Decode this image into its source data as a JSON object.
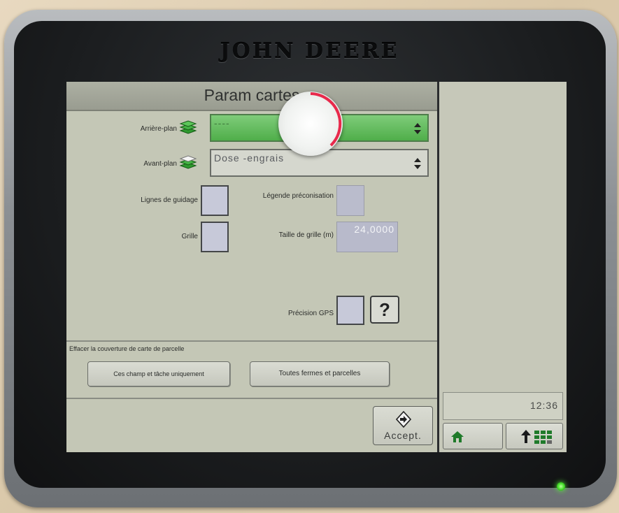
{
  "device": {
    "brand": "JOHN DEERE",
    "status_led_color": "#49e02c"
  },
  "screen": {
    "title": "Param cartes",
    "background_layer": {
      "label": "Arrière-plan",
      "value": "----",
      "icon": "layers-green-icon"
    },
    "foreground_layer": {
      "label": "Avant-plan",
      "value": "Dose -engrais",
      "icon": "layers-white-icon"
    },
    "guidance_lines": {
      "label": "Lignes de guidage",
      "checked": false
    },
    "prescription_legend": {
      "label": "Légende préconisation",
      "checked": false
    },
    "grid": {
      "label": "Grille",
      "checked": false
    },
    "grid_size": {
      "label": "Taille de grille (m)",
      "value": "24,0000"
    },
    "gps_precision": {
      "label": "Précision GPS",
      "checked": false,
      "help_label": "?"
    },
    "clear_coverage": {
      "heading": "Effacer la couverture de carte de parcelle",
      "this_field_button": "Ces champ et tâche uniquement",
      "all_farms_button": "Toutes fermes et parcelles"
    },
    "accept_button": "Accept."
  },
  "sidebar": {
    "time": "12:36",
    "home_icon": "home-icon",
    "menu_icon": "up-arrow-grid-icon"
  },
  "colors": {
    "screen_bg": "#c4c7b6",
    "selected_green": "#4fae4a",
    "touch_ring": "#e8294b"
  }
}
